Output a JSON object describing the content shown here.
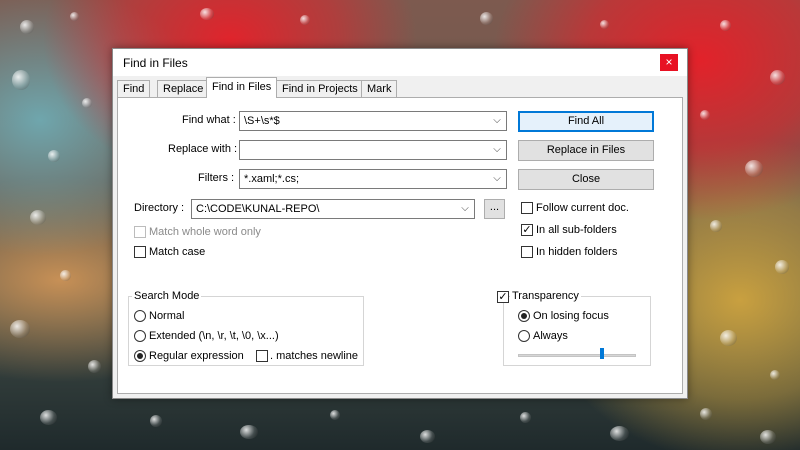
{
  "dialog": {
    "title": "Find in Files",
    "close_glyph": "×"
  },
  "tabs": [
    {
      "label": "Find"
    },
    {
      "label": "Replace"
    },
    {
      "label": "Find in Files"
    },
    {
      "label": "Find in Projects"
    },
    {
      "label": "Mark"
    }
  ],
  "active_tab": "Find in Files",
  "fields": {
    "find_what": {
      "label": "Find what :",
      "value": "\\S+\\s*$"
    },
    "replace_with": {
      "label": "Replace with :",
      "value": ""
    },
    "filters": {
      "label": "Filters :",
      "value": "*.xaml;*.cs;"
    },
    "directory": {
      "label": "Directory :",
      "value": "C:\\CODE\\KUNAL-REPO\\",
      "browse_label": "..."
    }
  },
  "buttons": {
    "find_all": "Find All",
    "replace_in_files": "Replace in Files",
    "close": "Close"
  },
  "options": {
    "match_whole_word": {
      "label": "Match whole word only",
      "checked": false,
      "enabled": false
    },
    "match_case": {
      "label": "Match case",
      "checked": false
    },
    "follow_current_doc": {
      "label": "Follow current doc.",
      "checked": false
    },
    "in_all_subfolders": {
      "label": "In all sub-folders",
      "checked": true
    },
    "in_hidden_folders": {
      "label": "In hidden folders",
      "checked": false
    }
  },
  "search_mode": {
    "title": "Search Mode",
    "normal": "Normal",
    "extended": "Extended (\\n, \\r, \\t, \\0, \\x...)",
    "regex": ". Regular expression",
    "regex_label": "Regular expression",
    "matches_newline": ". matches newline",
    "selected": "Regular expression"
  },
  "transparency": {
    "label": "Transparency",
    "checked": true,
    "on_losing_focus": "On losing focus",
    "always": "Always",
    "selected": "On losing focus",
    "slider_level": 0.7
  },
  "colors": {
    "accent": "#0078d7",
    "close_red": "#e81123"
  },
  "icons": {
    "dropdown": "chevron-down-icon",
    "check": "checkmark-icon"
  }
}
